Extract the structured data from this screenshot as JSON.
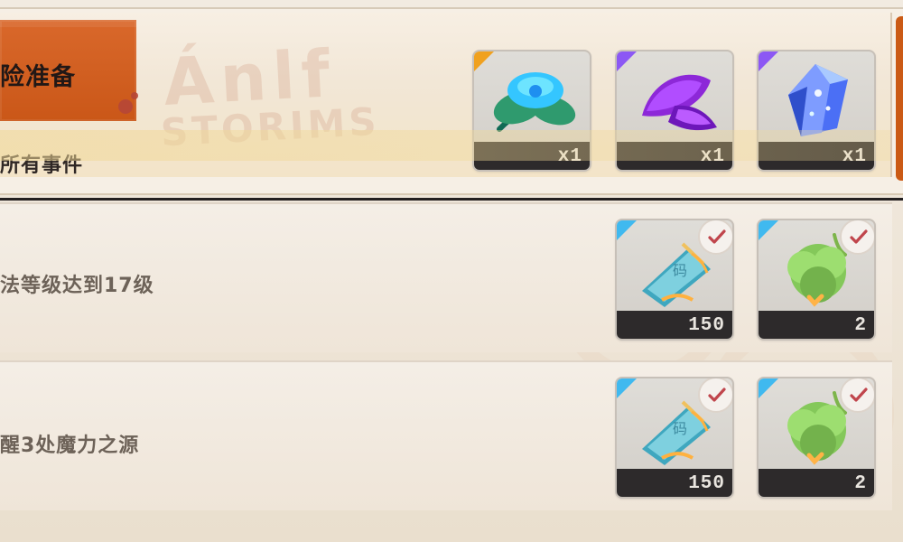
{
  "header": {
    "badge_title": "险准备",
    "subtitle": "所有事件",
    "watermark_top": "Ánlf",
    "watermark_bottom": "STORIMS"
  },
  "top_rewards": [
    {
      "name": "flower",
      "count": "x1",
      "corner_color": "#f0a11f"
    },
    {
      "name": "purple-petal",
      "count": "x1",
      "corner_color": "#8c58f4"
    },
    {
      "name": "blue-crystal",
      "count": "x1",
      "corner_color": "#40b9ef"
    }
  ],
  "rows": [
    {
      "text": "法等级达到17级",
      "rewards": [
        {
          "name": "blue-book",
          "count": "150",
          "corner_color": "#40b9ef",
          "claimed": true
        },
        {
          "name": "green-leaf",
          "count": "2",
          "corner_color": "#40b9ef",
          "claimed": true
        }
      ]
    },
    {
      "text": "醒3处魔力之源",
      "rewards": [
        {
          "name": "blue-book",
          "count": "150",
          "corner_color": "#40b9ef",
          "claimed": true
        },
        {
          "name": "green-leaf",
          "count": "2",
          "corner_color": "#40b9ef",
          "claimed": true
        }
      ]
    }
  ],
  "icons": {
    "check": "check-icon",
    "flower": "flower-icon",
    "petal": "purple-petal-icon",
    "crystal": "blue-crystal-icon",
    "book": "book-icon",
    "leaf": "leaf-icon"
  }
}
